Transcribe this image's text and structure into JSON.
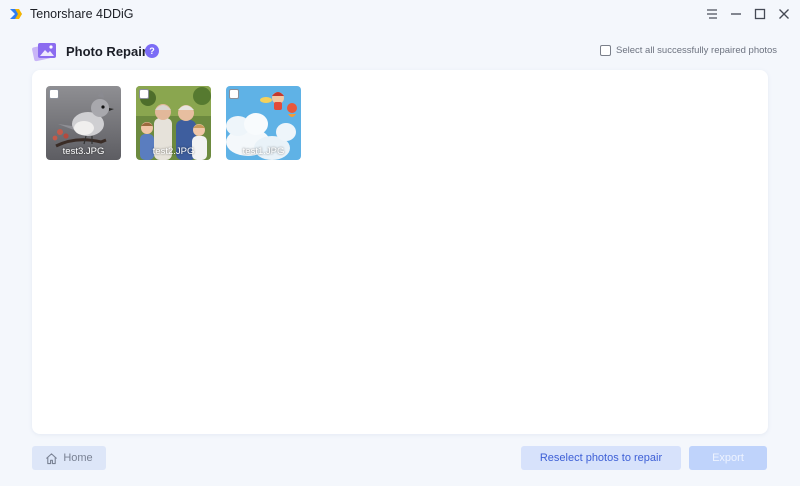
{
  "app": {
    "title": "Tenorshare 4DDiG",
    "brand_color": "#2f7df0"
  },
  "header": {
    "section_title": "Photo Repair",
    "help_glyph": "?",
    "select_all_label": "Select all successfully repaired photos",
    "select_all_checked": false
  },
  "photos": [
    {
      "name": "test3.JPG",
      "checked": false,
      "icon": "bird-photo"
    },
    {
      "name": "test2.JPG",
      "checked": false,
      "icon": "family-photo"
    },
    {
      "name": "test1.JPG",
      "checked": false,
      "icon": "anime-sky-photo"
    }
  ],
  "footer": {
    "home_label": "Home",
    "reselect_label": "Reselect photos to repair",
    "export_label": "Export"
  },
  "colors": {
    "accent": "#3d5fd6",
    "help_badge": "#7b6cf6",
    "export_disabled": "#bfd3fb"
  }
}
